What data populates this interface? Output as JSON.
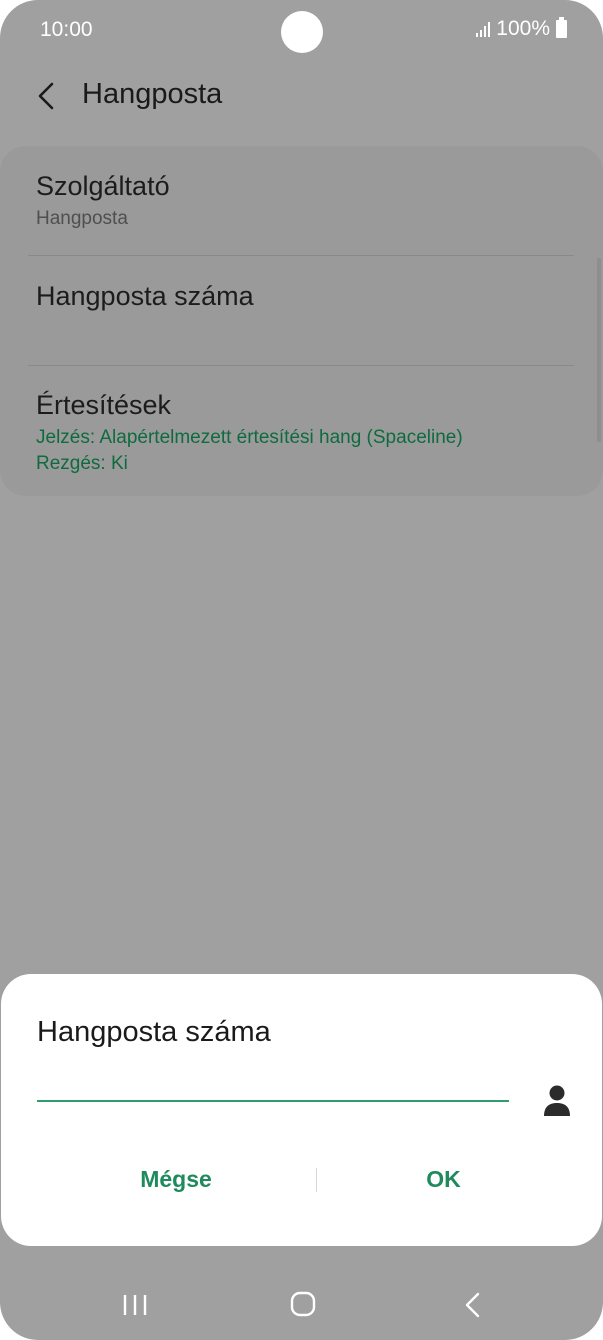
{
  "status_bar": {
    "time": "10:00",
    "battery_text": "100%",
    "icons": [
      "camera-cutout",
      "signal-icon",
      "battery-icon"
    ]
  },
  "header": {
    "title": "Hangposta",
    "back_icon": "back-arrow-icon"
  },
  "settings": {
    "items": [
      {
        "title": "Szolgáltató",
        "subtitle": "Hangposta"
      },
      {
        "title": "Hangposta száma"
      },
      {
        "title": "Értesítések",
        "detail_lines": [
          "Jelzés: Alapértelmezett értesítési hang (Spaceline)",
          "Rezgés: Ki"
        ]
      }
    ]
  },
  "dialog": {
    "title": "Hangposta száma",
    "input_value": "",
    "contact_icon": "person-icon",
    "cancel_label": "Mégse",
    "ok_label": "OK"
  },
  "nav_bar": {
    "icons": [
      "recents-icon",
      "home-icon",
      "back-icon"
    ]
  },
  "colors": {
    "accent": "#1f8a5c",
    "detail_text": "#0f6b3f",
    "dim_background": "#a0a0a0",
    "dialog_background": "#ffffff"
  }
}
